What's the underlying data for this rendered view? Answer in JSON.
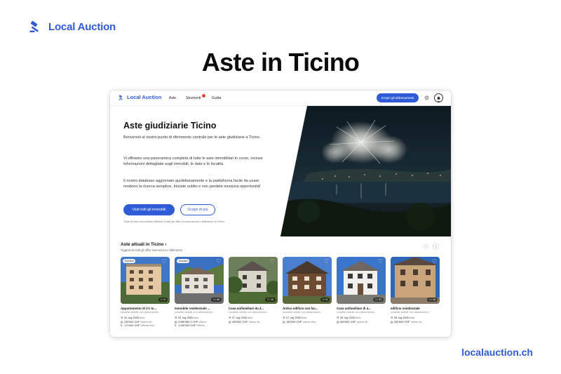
{
  "brand": {
    "name": "Local Auction",
    "icon": "gavel-icon",
    "color": "#2f5bd6"
  },
  "headline": "Aste in Ticino",
  "footer_url": "localauction.ch",
  "nav": {
    "brand": "Local Auction",
    "links": [
      "Aste",
      "Strumenti",
      "Guida"
    ],
    "cta": "Scopri gli abbonamenti"
  },
  "hero": {
    "title": "Aste giudiziarie Ticino",
    "p1": "Benvenuti al vostro punto di riferimento centrale per le aste giudiziarie a Ticino.",
    "p2": "Vi offriamo una panoramica completa di tutte le aste immobiliari in corso, incluse informazioni dettagliate sugli immobili, le date e le località.",
    "p3": "Il nostro database aggiornato quotidianamente e la piattaforma facile da usare rendono la ricerca semplice. Iniziate subito e non perdete nessuna opportunità!",
    "btn_primary": "Vedi tutti gli immobili",
    "btn_secondary": "Scopri di più",
    "note": "Tutte le aste immobiliari ufficiali di tutti gli uffici di esecuzione e fallimento in Ticino"
  },
  "section": {
    "title": "Aste attuali in Ticino ›",
    "subtitle": "Oggetti da tutti gli uffici esecuzioni e fallimento",
    "prev": "‹",
    "next": "›"
  },
  "cards": [
    {
      "tag": "Domani",
      "counter": "1 / 6",
      "title": "Appartamento di 2½ lo...",
      "sub": "Località visibile con abbonamen...",
      "date": "02. lug 2026",
      "date_suffix": "Asta",
      "value": "239'000 CHF",
      "value_suffix": "Valore sti...",
      "offer": "171'000 CHF",
      "offer_suffix": "Offerta mini..."
    },
    {
      "tag": "Domani",
      "counter": "1 / 46",
      "title": "Immobile residenziale ...",
      "sub": "Località visibile con abbonamen...",
      "date": "02. lug 2026",
      "date_suffix": "Asta",
      "value": "3'285'382.2 CHF",
      "value_suffix": "Valore...",
      "offer": "1'190'000 CHF",
      "offer_suffix": "Offerta ..."
    },
    {
      "tag": "",
      "counter": "1 / 16",
      "title": "Casa unifamiliare da 3...",
      "sub": "Località visibile con abbonamen...",
      "date": "07. lug 2026",
      "date_suffix": "Asta",
      "value": "490'500 CHF",
      "value_suffix": "Valore sti...",
      "offer": "",
      "offer_suffix": ""
    },
    {
      "tag": "",
      "counter": "1 / 8",
      "title": "Antico edificio con fac...",
      "sub": "Località visibile con abbonamen...",
      "date": "07. lug 2026",
      "date_suffix": "Asta",
      "value": "150'000 CHF",
      "value_suffix": "Valore stim...",
      "offer": "",
      "offer_suffix": ""
    },
    {
      "tag": "",
      "counter": "1 / 33",
      "title": "Casa unifamiliare di 4...",
      "sub": "Località visibile con abbonamen...",
      "date": "09. lug 2026",
      "date_suffix": "Asta",
      "value": "600'500 CHF",
      "value_suffix": "Valore sti...",
      "offer": "",
      "offer_suffix": ""
    },
    {
      "tag": "",
      "counter": "1 / 18",
      "title": "edificio residenziale",
      "sub": "Località visibile con abbonamen...",
      "date": "08. lug 2026",
      "date_suffix": "Asta",
      "value": "452'600 CHF",
      "value_suffix": "Valore sti...",
      "offer": "",
      "offer_suffix": ""
    }
  ]
}
